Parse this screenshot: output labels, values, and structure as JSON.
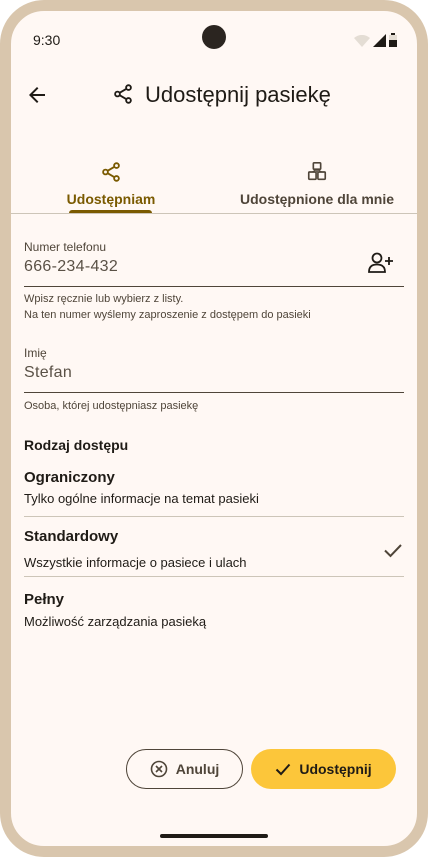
{
  "status_bar": {
    "time": "9:30"
  },
  "app_bar": {
    "title": "Udostępnij pasiekę"
  },
  "tabs": [
    {
      "label": "Udostępniam",
      "selected": true
    },
    {
      "label": "Udostępnione dla mnie",
      "selected": false
    }
  ],
  "phone_field": {
    "label": "Numer telefonu",
    "value": "666-234-432",
    "helper_line1": "Wpisz ręcznie lub wybierz z listy.",
    "helper_line2": "Na ten numer wyślemy zaproszenie z dostępem do pasieki"
  },
  "name_field": {
    "label": "Imię",
    "value": "Stefan",
    "helper": "Osoba, której udostępniasz pasiekę"
  },
  "access": {
    "title": "Rodzaj dostępu",
    "options": [
      {
        "title": "Ograniczony",
        "desc": "Tylko ogólne informacje na temat pasieki",
        "selected": false
      },
      {
        "title": "Standardowy",
        "desc": "Wszystkie informacje o pasiece i ulach",
        "selected": true
      },
      {
        "title": "Pełny",
        "desc": "Możliwość zarządzania pasieką",
        "selected": false
      }
    ]
  },
  "actions": {
    "cancel": "Anuluj",
    "share": "Udostępnij"
  },
  "colors": {
    "accent": "#7a5a00",
    "primary_button": "#fcc63a",
    "background": "#fff8f4",
    "frame": "#d9c6ad"
  }
}
